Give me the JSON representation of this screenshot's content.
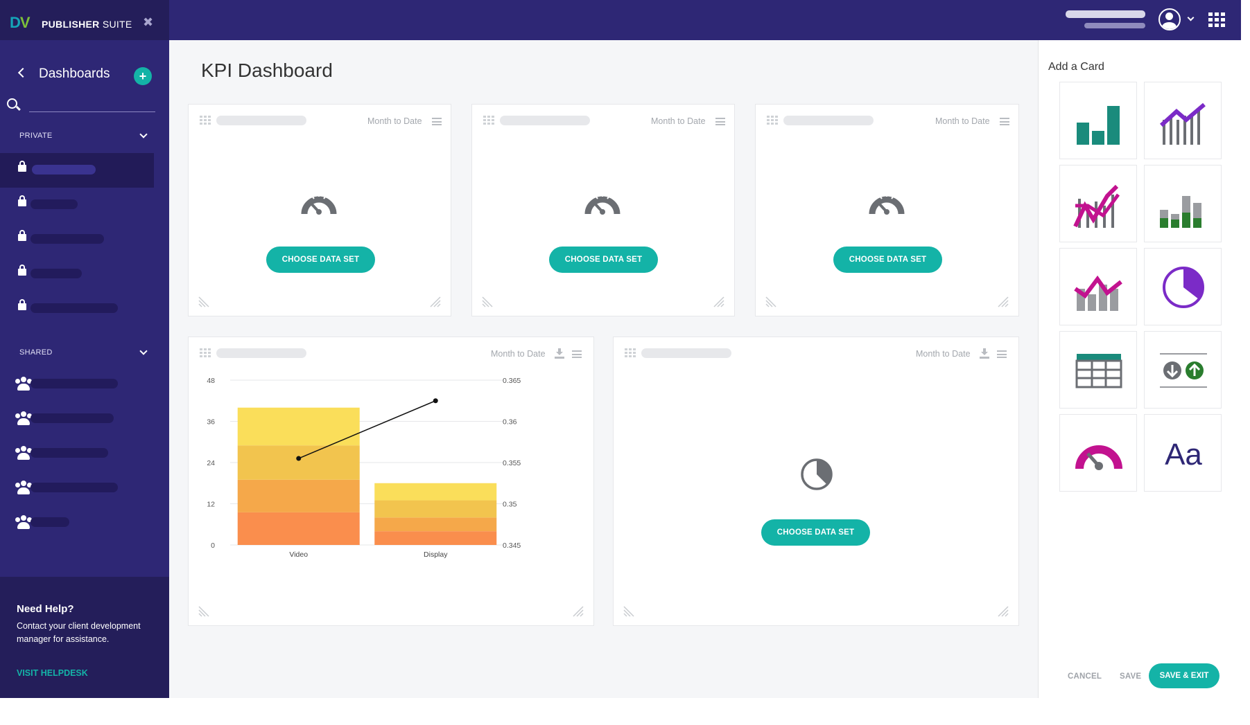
{
  "brand": {
    "logo_d": "D",
    "logo_v": "V",
    "title_bold": "PUBLISHER",
    "title_light": "SUITE"
  },
  "sidebar": {
    "heading": "Dashboards",
    "add_label": "+",
    "search_placeholder": "",
    "private_label": "PRIVATE",
    "shared_label": "SHARED",
    "help": {
      "heading": "Need Help?",
      "text": "Contact your client development manager for assistance.",
      "link": "VISIT HELPDESK"
    }
  },
  "page": {
    "title": "KPI Dashboard"
  },
  "cards": {
    "date_range": "Month to Date",
    "choose_label": "CHOOSE DATA SET"
  },
  "add_panel": {
    "heading": "Add a Card",
    "tiles": [
      "bar-chart-icon",
      "line-bar-chart-icon",
      "combo-chart-icon",
      "stacked-bar-chart-icon",
      "area-line-chart-icon",
      "pie-chart-icon",
      "table-icon",
      "compare-icon",
      "gauge-icon",
      "text-icon"
    ],
    "text_tile_label": "Aa"
  },
  "footer": {
    "cancel": "CANCEL",
    "save": "SAVE",
    "save_exit": "SAVE & EXIT"
  },
  "colors": {
    "teal": "#14b3a7",
    "navy": "#2e2775",
    "magenta": "#c2128f",
    "purple": "#7b2bc7",
    "dark_teal": "#1a8b7c",
    "green": "#2a7d2e"
  },
  "chart_data": {
    "type": "bar",
    "categories": [
      "Video",
      "Display"
    ],
    "series": [
      {
        "values": [
          9.5,
          4
        ]
      },
      {
        "values": [
          9.5,
          4
        ]
      },
      {
        "values": [
          10,
          5
        ]
      },
      {
        "values": [
          11,
          5
        ]
      }
    ],
    "line": {
      "values": [
        0.3555,
        0.3625
      ],
      "axis": "right"
    },
    "y_left": {
      "ticks": [
        "0",
        "12",
        "24",
        "36",
        "48"
      ],
      "range": [
        0,
        48
      ]
    },
    "y_right": {
      "ticks": [
        "0.345",
        "0.35",
        "0.355",
        "0.36",
        "0.365"
      ],
      "range": [
        0.345,
        0.365
      ]
    },
    "colors": [
      "#fa8e4d",
      "#f5a84a",
      "#f2c44e",
      "#fade5a"
    ],
    "grid": true
  }
}
